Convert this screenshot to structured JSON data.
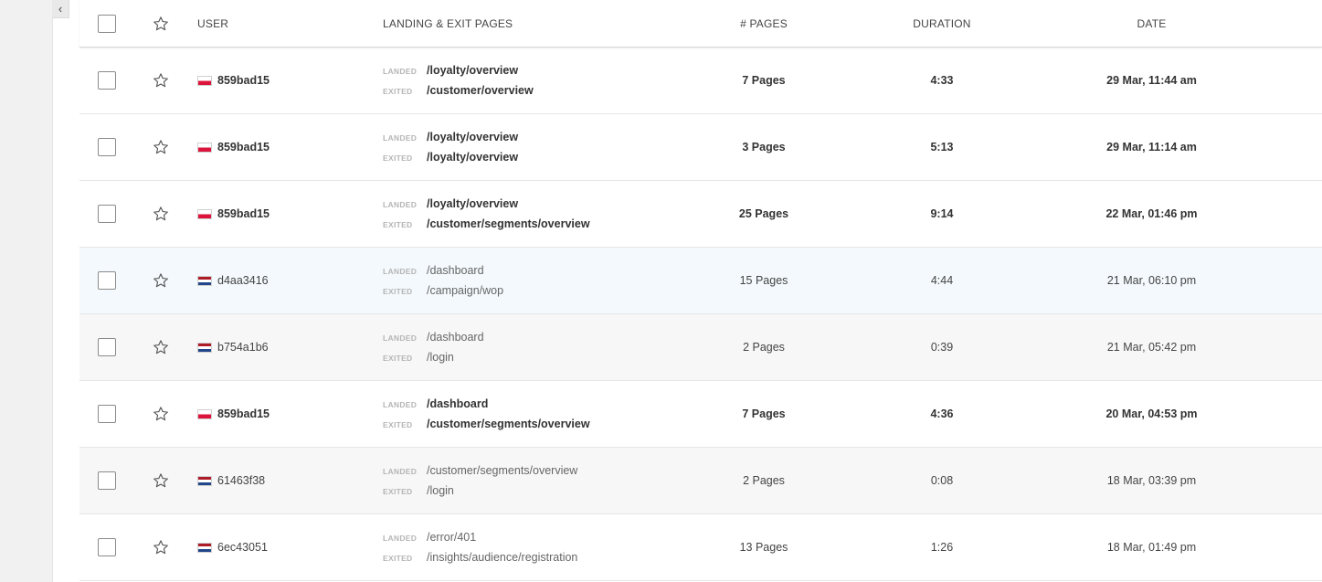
{
  "collapse_label": "‹",
  "header": {
    "user": "USER",
    "pages": "LANDING & EXIT PAGES",
    "num_pages": "# PAGES",
    "duration": "DURATION",
    "date": "DATE"
  },
  "labels": {
    "landed": "LANDED",
    "exited": "EXITED"
  },
  "flags": {
    "pl": "flag-poland-icon",
    "nl": "flag-netherlands-icon"
  },
  "rows": [
    {
      "user": "859bad15",
      "flag": "pl",
      "landed": "/loyalty/overview",
      "exited": "/customer/overview",
      "pages": "7 Pages",
      "duration": "4:33",
      "date": "29 Mar, 11:44 am",
      "bold": true
    },
    {
      "user": "859bad15",
      "flag": "pl",
      "landed": "/loyalty/overview",
      "exited": "/loyalty/overview",
      "pages": "3 Pages",
      "duration": "5:13",
      "date": "29 Mar, 11:14 am",
      "bold": true
    },
    {
      "user": "859bad15",
      "flag": "pl",
      "landed": "/loyalty/overview",
      "exited": "/customer/segments/overview",
      "pages": "25 Pages",
      "duration": "9:14",
      "date": "22 Mar, 01:46 pm",
      "bold": true
    },
    {
      "user": "d4aa3416",
      "flag": "nl",
      "landed": "/dashboard",
      "exited": "/campaign/wop",
      "pages": "15 Pages",
      "duration": "4:44",
      "date": "21 Mar, 06:10 pm",
      "bold": false
    },
    {
      "user": "b754a1b6",
      "flag": "nl",
      "landed": "/dashboard",
      "exited": "/login",
      "pages": "2 Pages",
      "duration": "0:39",
      "date": "21 Mar, 05:42 pm",
      "bold": false
    },
    {
      "user": "859bad15",
      "flag": "pl",
      "landed": "/dashboard",
      "exited": "/customer/segments/overview",
      "pages": "7 Pages",
      "duration": "4:36",
      "date": "20 Mar, 04:53 pm",
      "bold": true
    },
    {
      "user": "61463f38",
      "flag": "nl",
      "landed": "/customer/segments/overview",
      "exited": "/login",
      "pages": "2 Pages",
      "duration": "0:08",
      "date": "18 Mar, 03:39 pm",
      "bold": false
    },
    {
      "user": "6ec43051",
      "flag": "nl",
      "landed": "/error/401",
      "exited": "/insights/audience/registration",
      "pages": "13 Pages",
      "duration": "1:26",
      "date": "18 Mar, 01:49 pm",
      "bold": false
    }
  ]
}
